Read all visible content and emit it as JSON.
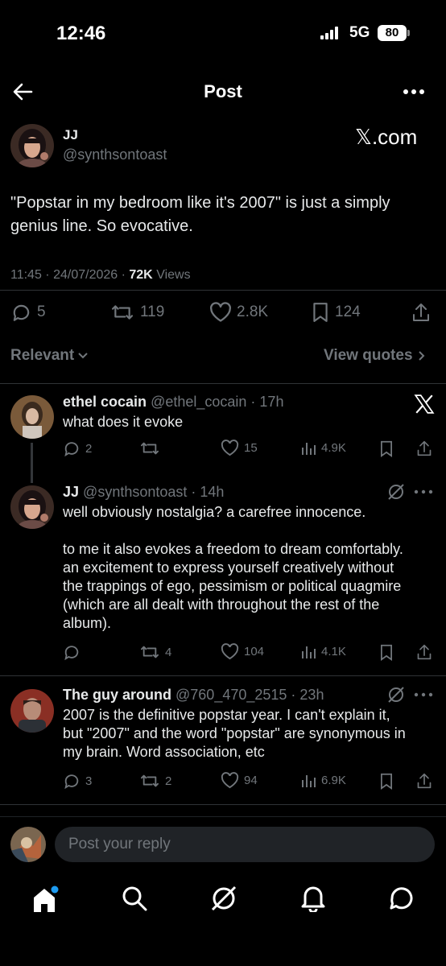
{
  "status_bar": {
    "time": "12:46",
    "network": "5G",
    "battery": "80"
  },
  "header": {
    "title": "Post"
  },
  "post": {
    "author_name": "JJ",
    "handle": "@synthsontoast",
    "source_watermark": "𝕏.com",
    "text": "\"Popstar in my bedroom like it's 2007\" is just a simply genius line. So evocative.",
    "time": "11:45",
    "date": "24/07/2026",
    "views_count": "72K",
    "views_label": "Views",
    "replies": "5",
    "reposts": "119",
    "likes": "2.8K",
    "bookmarks": "124"
  },
  "filter_bar": {
    "sort_label": "Relevant",
    "quotes_label": "View quotes"
  },
  "replies": [
    {
      "name": "ethel cocain",
      "handle": "@ethel_cocain",
      "age": "17h",
      "text": "what does it evoke",
      "replies": "2",
      "reposts": "",
      "likes": "15",
      "views": "4.9K"
    },
    {
      "name": "JJ",
      "handle": "@synthsontoast",
      "age": "14h",
      "text_lines": [
        "well obviously nostalgia? a carefree innocence.",
        "",
        "to me it also evokes a freedom to dream comfortably.",
        "an excitement to express yourself creatively without",
        "the trappings of ego, pessimism or political quagmire",
        "(which are all dealt with throughout the rest of the",
        "album)."
      ],
      "replies": "",
      "reposts": "4",
      "likes": "104",
      "views": "4.1K"
    },
    {
      "name": "The guy around",
      "handle": "@760_470_2515",
      "age": "23h",
      "text_lines": [
        "2007 is the definitive popstar year. I can't explain it,",
        "but \"2007\" and the word \"popstar\" are synonymous in",
        "my brain. Word association, etc"
      ],
      "replies": "3",
      "reposts": "2",
      "likes": "94",
      "views": "6.9K"
    }
  ],
  "composer": {
    "placeholder": "Post your reply"
  },
  "colors": {
    "background": "#000000",
    "text": "#e7e9ea",
    "secondary": "#71767b",
    "divider": "#2f3336",
    "accent": "#1d9bf0"
  }
}
